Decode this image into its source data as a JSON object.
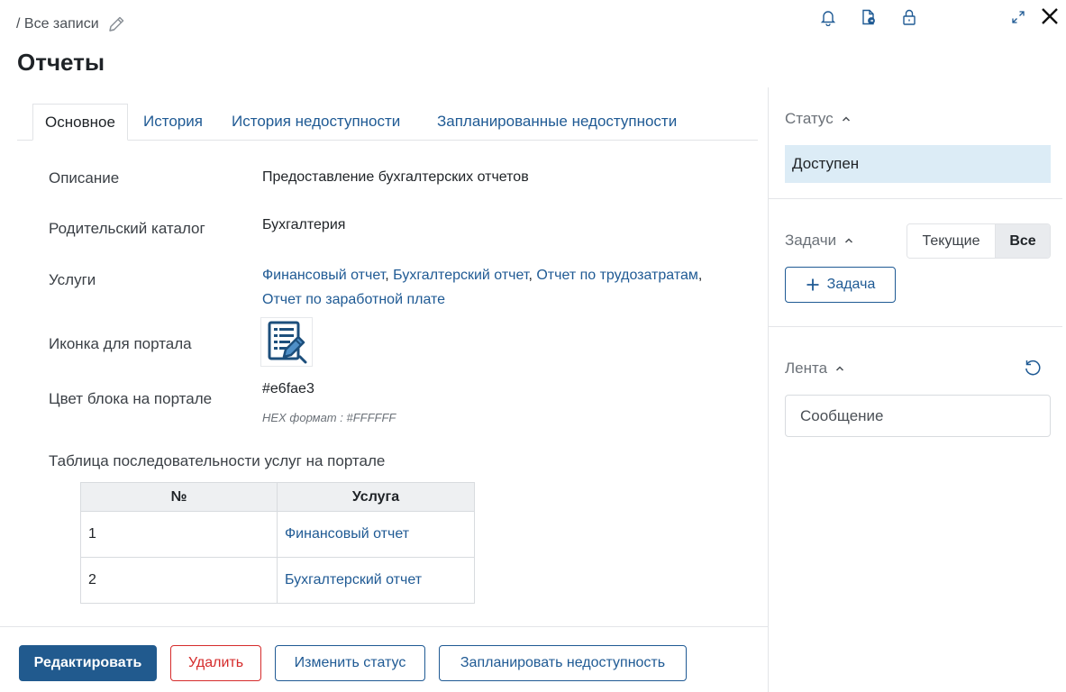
{
  "header": {
    "breadcrumb": "/ Все записи",
    "title": "Отчеты",
    "icons": [
      "bell-icon",
      "document-export-icon",
      "lock-icon",
      "expand-icon",
      "close-icon"
    ]
  },
  "tabs": [
    {
      "label": "Основное",
      "active": true
    },
    {
      "label": "История",
      "active": false
    },
    {
      "label": "История недоступности",
      "active": false
    },
    {
      "label": "Запланированные недоступности",
      "active": false
    }
  ],
  "fields": {
    "description": {
      "label": "Описание",
      "value": "Предоставление бухгалтерских отчетов"
    },
    "parent": {
      "label": "Родительский каталог",
      "value": "Бухгалтерия"
    },
    "services": {
      "label": "Услуги",
      "items": [
        "Финансовый отчет",
        "Бухгалтерский отчет",
        "Отчет по трудозатратам",
        "Отчет по заработной плате"
      ],
      "separator": ","
    },
    "portal_icon": {
      "label": "Иконка для портала",
      "icon": "document-pen-icon"
    },
    "block_color": {
      "label": "Цвет блока на портале",
      "value": "#e6fae3",
      "hint": "HEX формат : #FFFFFF"
    }
  },
  "sequence_table": {
    "title": "Таблица последовательности услуг на портале",
    "columns": [
      "№",
      "Услуга"
    ],
    "rows": [
      {
        "num": "1",
        "service": "Финансовый отчет"
      },
      {
        "num": "2",
        "service": "Бухгалтерский отчет"
      }
    ]
  },
  "actions": {
    "edit": "Редактировать",
    "delete": "Удалить",
    "change_status": "Изменить статус",
    "schedule": "Запланировать недоступность"
  },
  "right_panel": {
    "status": {
      "title": "Статус",
      "value": "Доступен"
    },
    "tasks": {
      "title": "Задачи",
      "current": "Текущие",
      "all": "Все",
      "add": "Задача"
    },
    "feed": {
      "title": "Лента",
      "placeholder": "Сообщение"
    }
  },
  "colors": {
    "accent": "#1f5a94",
    "primary_button": "#215a8e",
    "danger": "#d52b2b",
    "status_bg": "#dcecf6"
  }
}
